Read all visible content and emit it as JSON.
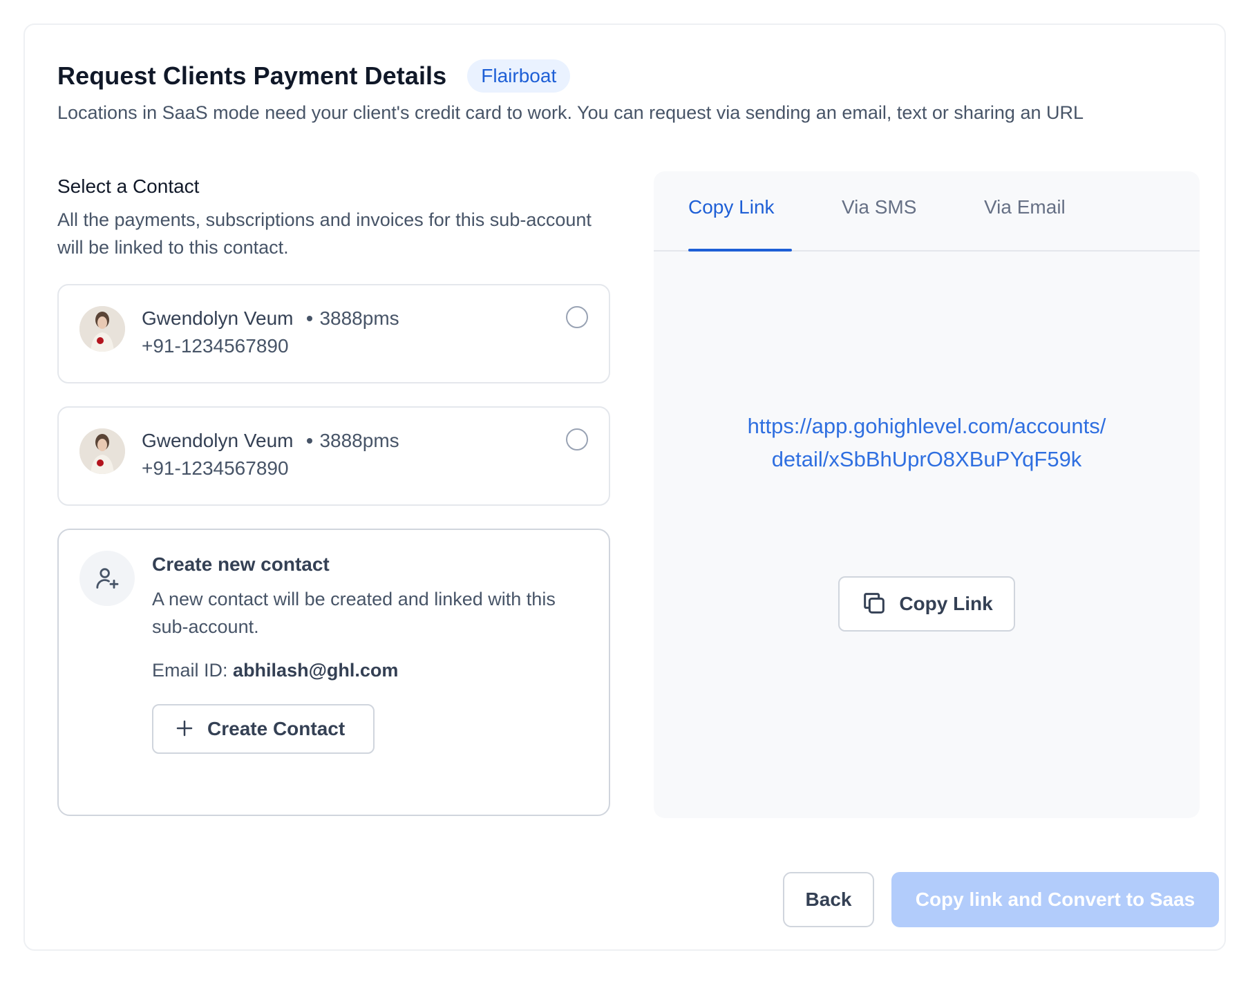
{
  "header": {
    "title": "Request Clients Payment Details",
    "badge": "Flairboat",
    "subtitle": "Locations in SaaS mode need your client's credit card to work. You can request via sending an email, text or sharing an URL"
  },
  "contact_section": {
    "title": "Select a Contact",
    "description": "All the payments, subscriptions and invoices for this sub-account will be linked to this contact."
  },
  "contacts": [
    {
      "name": "Gwendolyn Veum",
      "code": "3888pms",
      "phone": "+91-1234567890",
      "selected": false
    },
    {
      "name": "Gwendolyn Veum",
      "code": "3888pms",
      "phone": "+91-1234567890",
      "selected": false
    }
  ],
  "create_contact": {
    "title": "Create new contact",
    "description": "A new contact will be created and linked with this sub-account.",
    "email_label": "Email ID:",
    "email_value": "abhilash@ghl.com",
    "button_label": "Create Contact",
    "icon": "user-plus-icon"
  },
  "share_panel": {
    "tabs": [
      {
        "label": "Copy Link",
        "active": true
      },
      {
        "label": "Via SMS",
        "active": false
      },
      {
        "label": "Via Email",
        "active": false
      }
    ],
    "link_line1": "https://app.gohighlevel.com/accounts/",
    "link_line2": "detail/xSbBhUprO8XBuPYqF59k",
    "copy_button_label": "Copy Link",
    "copy_icon": "copy-icon"
  },
  "footer": {
    "back_label": "Back",
    "primary_label": "Copy link and Convert to Saas"
  },
  "colors": {
    "accent": "#1e5fd6",
    "badge_bg": "#eaf2ff",
    "primary_disabled_bg": "#b2ccfb",
    "panel_bg": "#f8f9fb"
  }
}
